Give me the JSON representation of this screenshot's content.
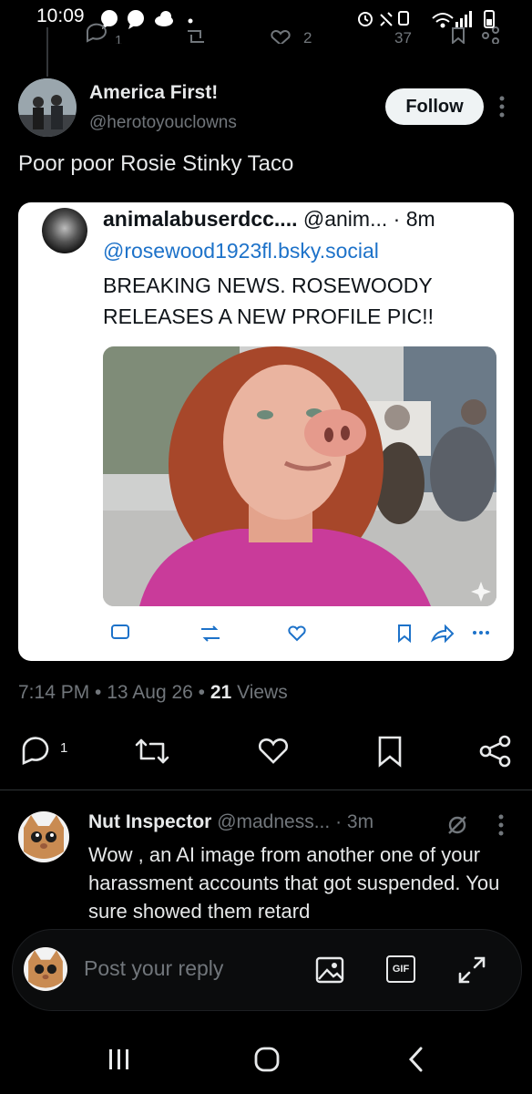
{
  "status_bar": {
    "time": "10:09",
    "icons": [
      "messenger-icon",
      "messenger-icon",
      "cloud-icon",
      "dot-icon",
      "alarm-icon",
      "mute-icon",
      "sim-icon",
      "wifi-icon",
      "signal-icon",
      "battery-icon"
    ]
  },
  "prev_actions": {
    "reply_count": "1",
    "like_count": "2",
    "views": "37"
  },
  "tweet": {
    "author_name": "America First!",
    "author_handle": "@herotoyouclowns",
    "follow_label": "Follow",
    "text": "Poor poor Rosie Stinky Taco",
    "meta_time": "7:14 PM",
    "meta_date": "13 Aug 26",
    "meta_views_count": "21",
    "meta_views_label": "Views",
    "reply_count": "1"
  },
  "embedded_post": {
    "name": "animalabuserdcc....",
    "handle": "@anim...",
    "age": "· 8m",
    "mention": "@rosewood1923fl.bsky.social",
    "body": "BREAKING NEWS. ROSEWOODY RELEASES A NEW PROFILE PIC!!"
  },
  "reply": {
    "name": "Nut Inspector",
    "handle": "@madness...",
    "age": "· 3m",
    "text": "Wow , an AI image from another one of your harassment accounts that got suspended.  You sure showed them retard"
  },
  "composer": {
    "placeholder": "Post your reply",
    "gif_label": "GIF"
  },
  "colors": {
    "background": "#000000",
    "text_primary": "#e7e9ea",
    "text_muted": "#71767b",
    "link_blue": "#1d72c9",
    "follow_bg": "#eff3f4"
  }
}
